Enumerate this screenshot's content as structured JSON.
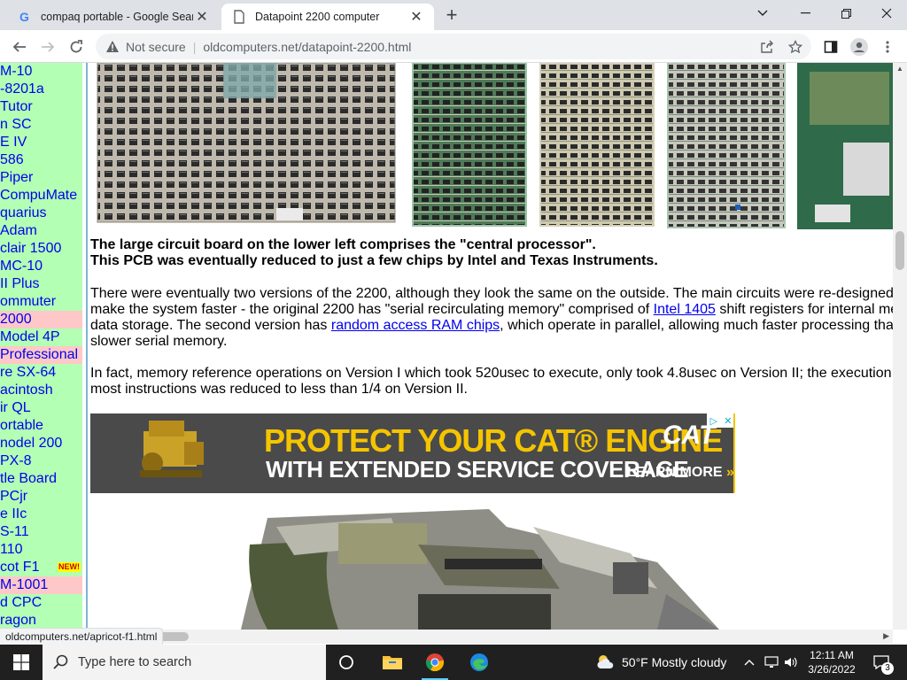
{
  "browser": {
    "tabs": [
      {
        "title": "compaq portable - Google Searc",
        "icon": "google-icon",
        "active": false
      },
      {
        "title": "Datapoint 2200 computer",
        "icon": "page-icon",
        "active": true
      }
    ],
    "address": {
      "security_label": "Not secure",
      "url": "oldcomputers.net/datapoint-2200.html"
    },
    "status_url": "oldcomputers.net/apricot-f1.html"
  },
  "sidebar": {
    "items": [
      {
        "label": "M-10",
        "highlight": false
      },
      {
        "label": "-8201a",
        "highlight": false
      },
      {
        "label": "Tutor",
        "highlight": false
      },
      {
        "label": "n SC",
        "highlight": false
      },
      {
        "label": "E IV",
        "highlight": false
      },
      {
        "label": "586",
        "highlight": false
      },
      {
        "label": "Piper",
        "highlight": false
      },
      {
        "label": "CompuMate",
        "highlight": false
      },
      {
        "label": "quarius",
        "highlight": false
      },
      {
        "label": "Adam",
        "highlight": false
      },
      {
        "label": "clair 1500",
        "highlight": false
      },
      {
        "label": "MC-10",
        "highlight": false
      },
      {
        "label": "II Plus",
        "highlight": false
      },
      {
        "label": "ommuter",
        "highlight": false
      },
      {
        "label": "2000",
        "highlight": true
      },
      {
        "label": "Model 4P",
        "highlight": false
      },
      {
        "label": "Professional",
        "highlight": true
      },
      {
        "label": "re SX-64",
        "highlight": false
      },
      {
        "label": "acintosh",
        "highlight": false
      },
      {
        "label": "ir QL",
        "highlight": false
      },
      {
        "label": "ortable",
        "highlight": false
      },
      {
        "label": "nodel 200",
        "highlight": false
      },
      {
        "label": "PX-8",
        "highlight": false
      },
      {
        "label": "tle Board",
        "highlight": false
      },
      {
        "label": "PCjr",
        "highlight": false
      },
      {
        "label": "e IIc",
        "highlight": false
      },
      {
        "label": "S-11",
        "highlight": false
      },
      {
        "label": "110",
        "highlight": false
      },
      {
        "label": "cot F1",
        "highlight": false,
        "badge": "NEW!"
      },
      {
        "label": "M-1001",
        "highlight": true
      },
      {
        "label": "d CPC",
        "highlight": false
      },
      {
        "label": "ragon",
        "highlight": false
      }
    ]
  },
  "article": {
    "caption_line1": "The large circuit board on the lower left comprises the \"central processor\".",
    "caption_line2": "This PCB was eventually reduced to just a few chips by Intel and Texas Instruments.",
    "para1_line1": "There were eventually two versions of the 2200, although they look the same on the outside. The main circuits were re-designed",
    "para1_line2_pre": "make the system faster - the original 2200 has \"serial recirculating memory\" comprised of ",
    "para1_link1": "Intel 1405",
    "para1_line2_post": " shift registers for internal me",
    "para1_line3_pre": "data storage. The second version has ",
    "para1_link2": "random access RAM chips",
    "para1_line3_post": ", which operate in parallel, allowing much faster processing tha",
    "para1_line4": "slower serial memory.",
    "para2_line1": "In fact, memory reference operations on Version I which took 520usec to execute, only took 4.8usec on Version II; the execution",
    "para2_line2": "most instructions was reduced to less than 1/4 on Version II."
  },
  "ad": {
    "headline": "PROTECT YOUR CAT® ENGINE",
    "subline": "WITH EXTENDED SERVICE COVERAGE",
    "brand": "CAT",
    "cta": "LEARN MORE",
    "cta_chevrons": "»"
  },
  "taskbar": {
    "search_placeholder": "Type here to search",
    "weather": "50°F  Mostly cloudy",
    "time": "12:11 AM",
    "date": "3/26/2022",
    "notification_count": "3"
  },
  "colors": {
    "sidebar_bg": "#b3ffb3",
    "sidebar_highlight": "#ffc8c8",
    "link": "#0000ee",
    "ad_yellow": "#f5c400"
  }
}
